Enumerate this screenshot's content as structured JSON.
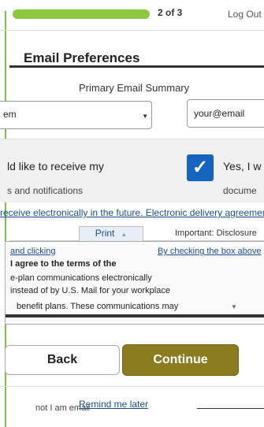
{
  "header": {
    "progress_fraction": 1.0,
    "step_label": "2 of 3",
    "logout_label": "Log Out"
  },
  "section": {
    "heading": "Email Preferences",
    "subtitle": "Primary Email Summary"
  },
  "fields": {
    "select_value": "em",
    "email_value": "your@email"
  },
  "preferences": {
    "left_text": "ld like to receive my",
    "left_text2": "s and notifications",
    "right_text": "Yes, I w",
    "right_text2": "docume",
    "checked": true
  },
  "link_text": "receive electronically in the future. Electronic delivery agreement",
  "toolbar": {
    "print_label": "Print",
    "important_label": "Important: Disclosure"
  },
  "doc": {
    "line1": "and clicking",
    "line1b": "By checking the box above",
    "line2": "I agree to the terms of the",
    "line3": "e-plan communications electronically",
    "line4": "instead of by U.S. Mail for your workplace",
    "line5": "benefit plans. These communications may"
  },
  "buttons": {
    "back_label": "Back",
    "continue_label": "Continue"
  },
  "footer": {
    "left_text": "not I am email",
    "remind_label": "Remind me later"
  },
  "colors": {
    "accent_green": "#8dc63f",
    "continue_button": "#8b7d1f",
    "checkbox_blue": "#1565c0",
    "link_blue": "#1a4f8b"
  }
}
